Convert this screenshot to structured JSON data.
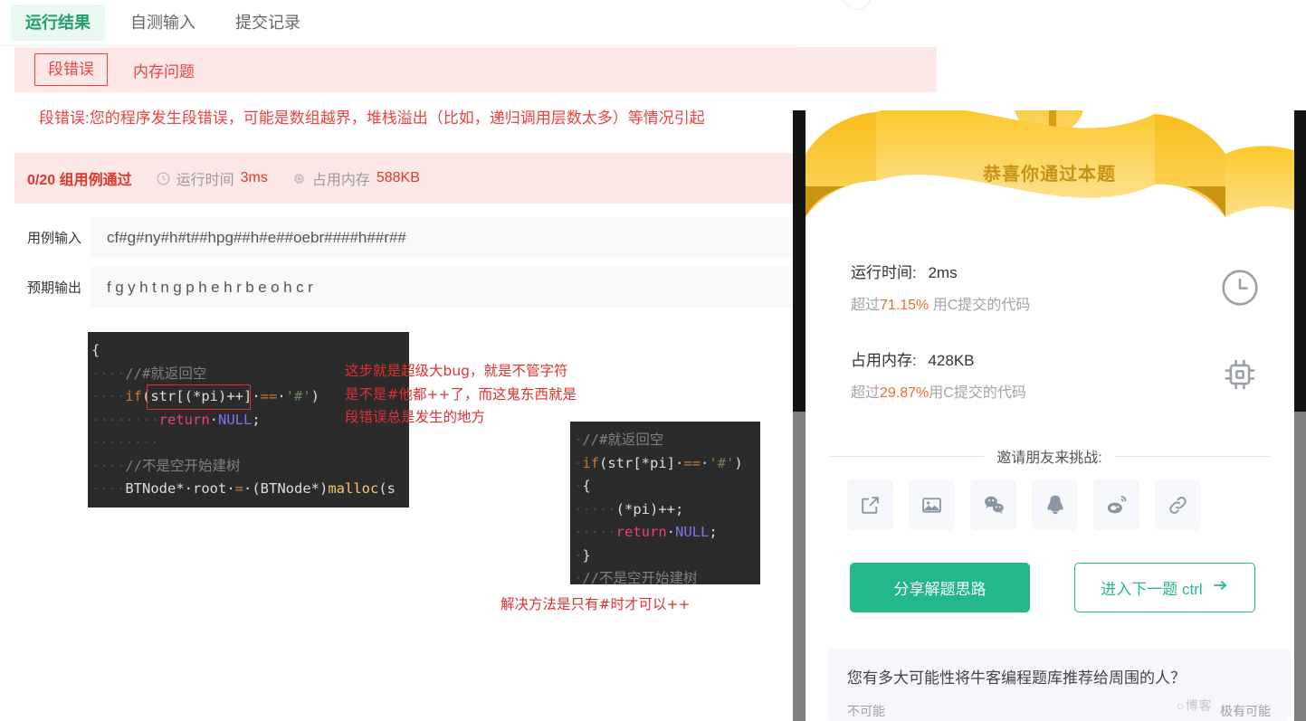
{
  "tabs": [
    {
      "label": "运行结果",
      "active": true
    },
    {
      "label": "自测输入",
      "active": false
    },
    {
      "label": "提交记录",
      "active": false
    }
  ],
  "error": {
    "badge": "段错误",
    "kind": "内存问题",
    "description": "段错误:您的程序发生段错误，可能是数组越界，堆栈溢出（比如，递归调用层数太多）等情况引起"
  },
  "stats": {
    "pass_count": "0/20 组用例通过",
    "runtime_label": "运行时间",
    "runtime_value": "3ms",
    "memory_label": "占用内存",
    "memory_value": "588KB",
    "clock_icon": "clock-icon",
    "chip_icon": "chip-icon"
  },
  "io": {
    "input_label": "用例输入",
    "input_value": "cf#g#ny#h#t##hpg##h#e##oebr####h##r##",
    "output_label": "预期输出",
    "output_value": "fgyhtngphehrbeohcr"
  },
  "code_buggy": {
    "lines": [
      [
        {
          "t": "{",
          "c": "plain"
        }
      ],
      [
        {
          "t": "····",
          "c": "dot"
        },
        {
          "t": "//#就返回空",
          "c": "cmt"
        }
      ],
      [
        {
          "t": "····",
          "c": "dot"
        },
        {
          "t": "if",
          "c": "kw"
        },
        {
          "t": "(str[(*pi)++]·",
          "c": "plain"
        },
        {
          "t": "==",
          "c": "kw"
        },
        {
          "t": "·",
          "c": "plain"
        },
        {
          "t": "'#'",
          "c": "str"
        },
        {
          "t": ")",
          "c": "plain"
        }
      ],
      [
        {
          "t": "········",
          "c": "dot"
        },
        {
          "t": "return",
          "c": "ret"
        },
        {
          "t": "·",
          "c": "plain"
        },
        {
          "t": "NULL",
          "c": "null"
        },
        {
          "t": ";",
          "c": "plain"
        }
      ],
      [
        {
          "t": "········",
          "c": "dot"
        }
      ],
      [
        {
          "t": "····",
          "c": "dot"
        },
        {
          "t": "//不是空开始建树",
          "c": "cmt"
        }
      ],
      [
        {
          "t": "····",
          "c": "dot"
        },
        {
          "t": "BTNode*",
          "c": "plain"
        },
        {
          "t": "·root·",
          "c": "plain"
        },
        {
          "t": "=",
          "c": "kw"
        },
        {
          "t": "·(BTNode*)",
          "c": "plain"
        },
        {
          "t": "malloc",
          "c": "fn"
        },
        {
          "t": "(s",
          "c": "plain"
        }
      ]
    ]
  },
  "code_fixed": {
    "lines": [
      [
        {
          "t": "·",
          "c": "dot"
        },
        {
          "t": "//#就返回空",
          "c": "cmt"
        }
      ],
      [
        {
          "t": "·",
          "c": "dot"
        },
        {
          "t": "if",
          "c": "kw"
        },
        {
          "t": "(str[*pi]·",
          "c": "plain"
        },
        {
          "t": "==",
          "c": "kw"
        },
        {
          "t": "·",
          "c": "plain"
        },
        {
          "t": "'#'",
          "c": "str"
        },
        {
          "t": ")",
          "c": "plain"
        }
      ],
      [
        {
          "t": "·",
          "c": "dot"
        },
        {
          "t": "{",
          "c": "plain"
        }
      ],
      [
        {
          "t": "·····",
          "c": "dot"
        },
        {
          "t": "(*pi)++;",
          "c": "plain"
        }
      ],
      [
        {
          "t": "·····",
          "c": "dot"
        },
        {
          "t": "return",
          "c": "ret"
        },
        {
          "t": "·",
          "c": "plain"
        },
        {
          "t": "NULL",
          "c": "null"
        },
        {
          "t": ";",
          "c": "plain"
        }
      ],
      [
        {
          "t": "·",
          "c": "dot"
        },
        {
          "t": "}",
          "c": "plain"
        }
      ],
      [
        {
          "t": "·",
          "c": "dot"
        },
        {
          "t": "//不是空开始建树",
          "c": "cmt"
        }
      ]
    ]
  },
  "annotations": {
    "bug_note": "这步就是超级大bug，就是不管字符\n是不是#他都++了，而这鬼东西就是\n段错误总是发生的地方",
    "fix_note": "解决方法是只有#时才可以++"
  },
  "modal": {
    "banner_title": "恭喜你通过本题",
    "runtime": {
      "label": "运行时间:",
      "value": "2ms",
      "beat_prefix": "超过",
      "beat_pct": "71.15%",
      "beat_suffix": " 用C提交的代码",
      "icon": "clock-icon"
    },
    "memory": {
      "label": "占用内存:",
      "value": "428KB",
      "beat_prefix": "超过",
      "beat_pct": "29.87%",
      "beat_suffix": "用C提交的代码",
      "icon": "chip-icon"
    },
    "invite_label": "邀请朋友来挑战:",
    "share_icons": [
      "external-link-icon",
      "image-icon",
      "wechat-icon",
      "qq-icon",
      "weibo-icon",
      "link-icon"
    ],
    "share_button": "分享解题思路",
    "next_button": "进入下一题 ctrl",
    "next_arrow": "arrow-right-icon",
    "survey": {
      "question": "您有多大可能性将牛客编程题库推荐给周围的人？",
      "low_label": "不可能",
      "high_label": "极有可能"
    }
  },
  "watermark": "○博客",
  "colors": {
    "accent_green": "#23b88b",
    "error_red": "#f04040",
    "banner_gold": "#f7c948",
    "pct_orange": "#f56a32"
  }
}
